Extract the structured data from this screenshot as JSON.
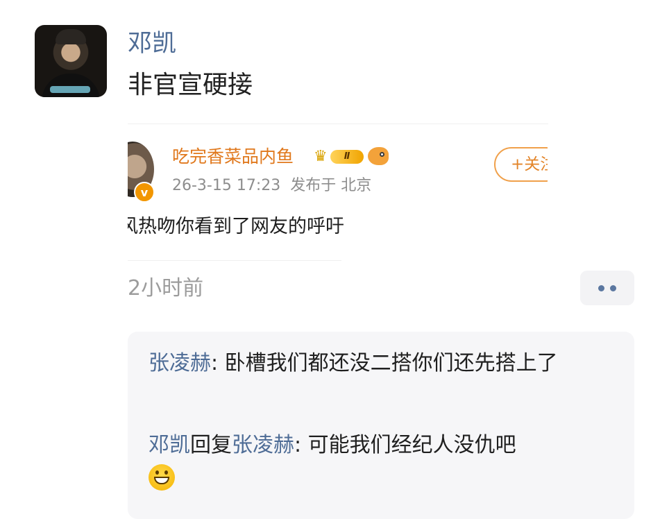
{
  "post": {
    "author_name": "邓凯",
    "text": "非官宣硬接"
  },
  "quoted": {
    "author_name": "吃完香菜品内鱼",
    "vip_level": "Ⅱ",
    "meta": "26-3-15 17:23  发布于 北京",
    "follow_label": "+关注",
    "body": "风热吻你看到了网友的呼吁"
  },
  "post_time": "2小时前",
  "replies": [
    {
      "name": "张凌赫",
      "separator": ": ",
      "text": "卧槽我们都还没二搭你们还先搭上了"
    },
    {
      "name": "邓凯",
      "reply_word": "回复",
      "target": "张凌赫",
      "separator": ": ",
      "text": "可能我们经纪人没仇吧"
    }
  ],
  "icons": {
    "verified": "verified-badge-icon",
    "crown": "crown-icon",
    "fish": "fish-icon",
    "more": "more-dots-icon",
    "emoji": "grinning-face-emoji"
  },
  "colors": {
    "name_link": "#4e6c96",
    "quote_author": "#e0781c",
    "follow_border": "#f0a04a",
    "reply_bg": "#f6f6f8"
  }
}
